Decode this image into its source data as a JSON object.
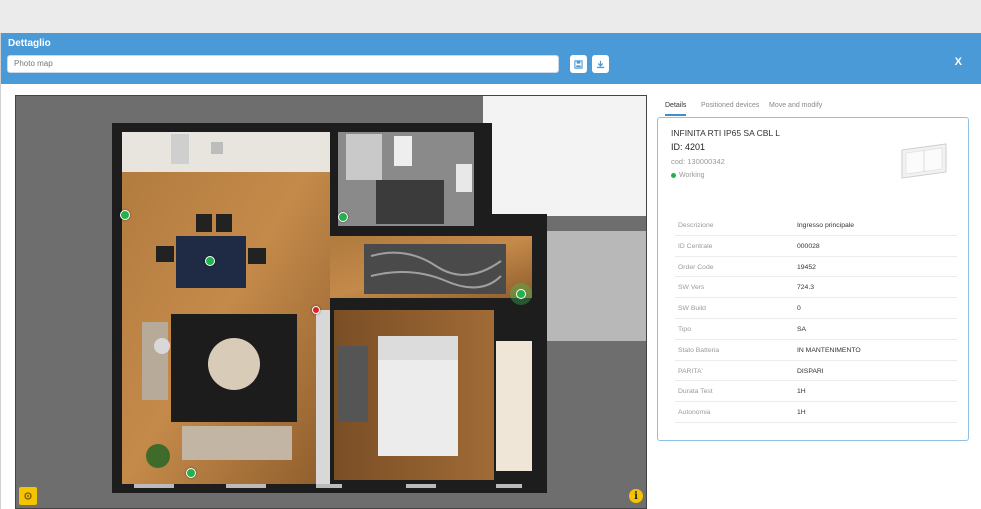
{
  "dialog": {
    "title": "Dettaglio",
    "map_select_value": "Photo map",
    "close_label": "X"
  },
  "tabs": [
    {
      "label": "Details",
      "active": true
    },
    {
      "label": "Positioned devices",
      "active": false
    },
    {
      "label": "Move and modify",
      "active": false
    }
  ],
  "device": {
    "name": "INFINITA RTI IP65 SA CBL L",
    "id": "ID: 4201",
    "cod": "cod: 130000342",
    "status": "Working",
    "status_color": "#22b24c"
  },
  "properties": [
    {
      "key": "Descrizione",
      "value": "Ingresso principale"
    },
    {
      "key": "ID Centrale",
      "value": "000028"
    },
    {
      "key": "Order Code",
      "value": "19452"
    },
    {
      "key": "SW Vers",
      "value": "724.3"
    },
    {
      "key": "SW Build",
      "value": "0"
    },
    {
      "key": "Tipo",
      "value": "SA"
    },
    {
      "key": "Stato Batteria",
      "value": "IN MANTENIMENTO"
    },
    {
      "key": "PARITA'",
      "value": "DISPARI"
    },
    {
      "key": "Durata Test",
      "value": "1H"
    },
    {
      "key": "Autonomia",
      "value": "1H"
    }
  ],
  "icons": {
    "save": "save-icon",
    "download": "download-icon",
    "map_tool": "settings-icon",
    "info": "info-icon"
  },
  "colors": {
    "header": "#4a9ad8",
    "accent": "#3a8fd0",
    "marker_ok": "#22b24c",
    "marker_alarm": "#e02020",
    "tool_button": "#f5c400"
  }
}
